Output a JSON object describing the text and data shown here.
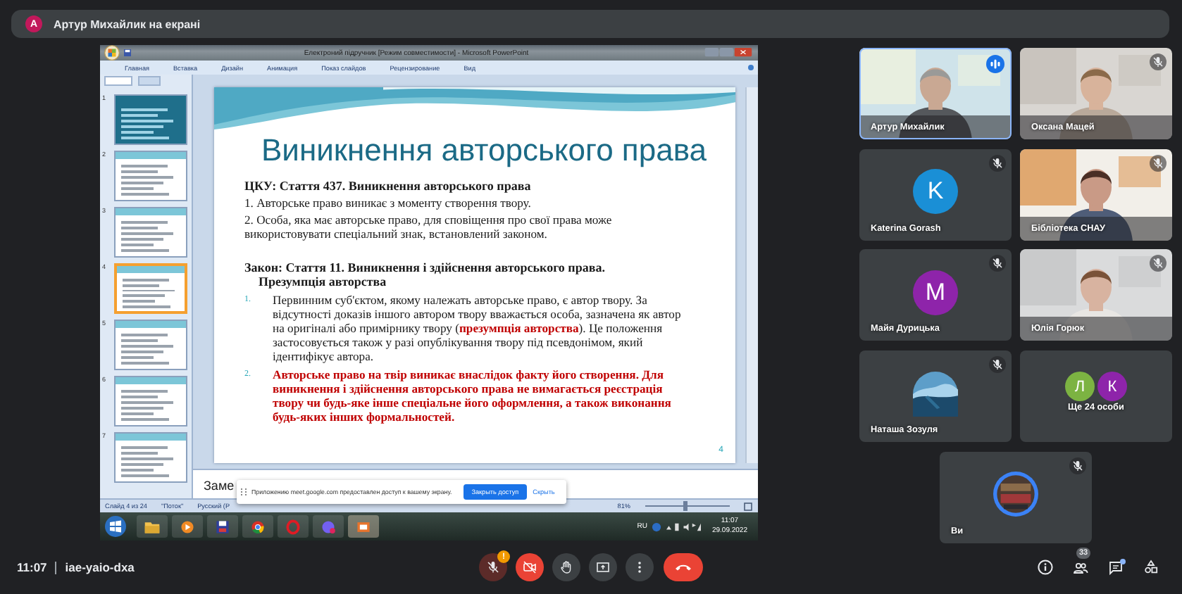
{
  "banner": {
    "avatar": "А",
    "text": "Артур Михайлик на екрані"
  },
  "powerpoint": {
    "title": "Електроний підручник [Режим совместимости] - Microsoft PowerPoint",
    "tabs": [
      "Главная",
      "Вставка",
      "Дизайн",
      "Анимация",
      "Показ слайдов",
      "Рецензирование",
      "Вид"
    ],
    "thumbnails": [
      {
        "number": "1",
        "selected": false
      },
      {
        "number": "2",
        "selected": false
      },
      {
        "number": "3",
        "selected": false
      },
      {
        "number": "4",
        "selected": true
      },
      {
        "number": "5",
        "selected": false
      },
      {
        "number": "6",
        "selected": false
      },
      {
        "number": "7",
        "selected": false
      }
    ],
    "slide": {
      "title": "Виникнення авторського права",
      "sections": [
        {
          "heading": "ЦКУ: Стаття 437. Виникнення авторського права",
          "paragraphs": [
            "1. Авторське право виникає з моменту створення твору.",
            "2. Особа,  яка має авторське право,  для сповіщення про  свої права може використовувати спеціальний знак, встановлений законом."
          ]
        },
        {
          "heading": "Закон: Стаття 11. Виникнення і здійснення авторського права.",
          "subheading": "Презумпція авторства",
          "items": [
            {
              "number": "1.",
              "text": "Первинним суб'єктом, якому належать авторське право, є автор твору. За відсутності доказів іншого автором твору вважається особа, зазначена як автор на оригіналі або примірнику твору (**презумпція авторства**). Це положення застосовується також у разі опублікування твору під псевдонімом, який ідентифікує автора."
            },
            {
              "number": "2.",
              "text": "**Авторське право на твір виникає внаслідок факту його створення. Для виникнення і здійснення авторського права не вимагається реєстрація твору чи будь-яке інше спеціальне його оформлення, а також виконання будь-яких інших формальностей.**"
            }
          ]
        }
      ],
      "page": "4"
    },
    "notes": "Заме",
    "status": [
      "Слайд 4 из 24",
      "\"Поток\"",
      "Русский (Р"
    ],
    "zoom": "81%",
    "zoom_slider": {
      "level": 0.45
    }
  },
  "notification": {
    "text": "Приложению meet.google.com предоставлен доступ к вашему экрану.",
    "button": "Закрыть доступ",
    "link": "Скрыть"
  },
  "taskbar": {
    "language": "RU",
    "time": "11:07",
    "date": "29.09.2022"
  },
  "tiles": [
    {
      "name": "Артур Михайлик",
      "kind": "video",
      "speaking": true,
      "muted": false
    },
    {
      "name": "Оксана Мацей",
      "kind": "video",
      "speaking": false,
      "muted": true
    },
    {
      "name": "Katerina Gorash",
      "kind": "letter",
      "avatar": "K",
      "color": "#1a8fd6",
      "speaking": false,
      "muted": true
    },
    {
      "name": "Бібліотека СНАУ",
      "kind": "video",
      "speaking": false,
      "muted": true
    },
    {
      "name": "Майя Дурицька",
      "kind": "letter",
      "avatar": "M",
      "color": "#8e24aa",
      "speaking": false,
      "muted": true
    },
    {
      "name": "Юлія Горюк",
      "kind": "video",
      "speaking": false,
      "muted": true
    },
    {
      "name": "Наташа Зозуля",
      "speaking": false,
      "muted": true
    },
    {
      "name": "Ще 24 особи",
      "kind": "group",
      "avatars": [
        {
          "letter": "Л",
          "color": "#7cb342"
        },
        {
          "letter": "К",
          "color": "#8e24aa"
        }
      ],
      "speaking": false,
      "muted": false
    },
    {
      "name": "Ви",
      "kind": "self",
      "speaking": false,
      "muted": true
    }
  ],
  "meeting": {
    "time": "11:07",
    "code": "iae-yaio-dxa"
  },
  "controls": {
    "mic_on": false,
    "mic_warning": "!",
    "camera_on": false
  },
  "people_count": "33",
  "chat_unread": true
}
